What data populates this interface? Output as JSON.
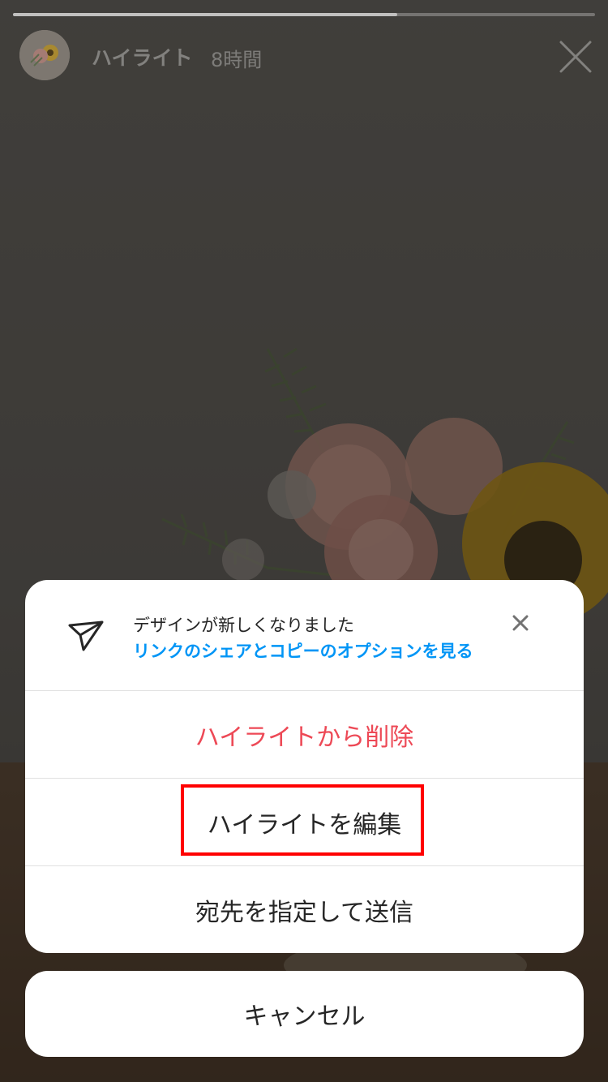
{
  "story": {
    "title": "ハイライト",
    "time": "8時間",
    "progress": 0.66
  },
  "banner": {
    "title": "デザインが新しくなりました",
    "link": "リンクのシェアとコピーのオプションを見る"
  },
  "options": [
    {
      "label": "ハイライトから削除"
    },
    {
      "label": "ハイライトを編集"
    },
    {
      "label": "宛先を指定して送信"
    }
  ],
  "cancel": {
    "label": "キャンセル"
  },
  "colors": {
    "danger": "#ed4956",
    "link": "#0095f6",
    "annotation": "#ff0000"
  }
}
